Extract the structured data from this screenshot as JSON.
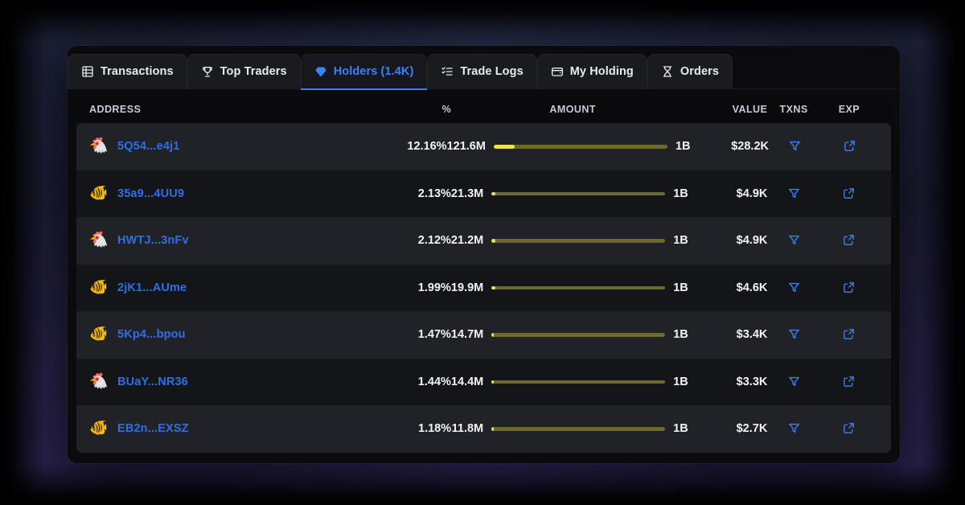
{
  "tabs": [
    {
      "id": "transactions",
      "label": "Transactions",
      "icon": "list-table-icon",
      "active": false
    },
    {
      "id": "top-traders",
      "label": "Top Traders",
      "icon": "trophy-icon",
      "active": false
    },
    {
      "id": "holders",
      "label": "Holders (1.4K)",
      "icon": "gem-icon",
      "active": true
    },
    {
      "id": "trade-logs",
      "label": "Trade Logs",
      "icon": "list-check-icon",
      "active": false
    },
    {
      "id": "my-holding",
      "label": "My Holding",
      "icon": "wallet-icon",
      "active": false
    },
    {
      "id": "orders",
      "label": "Orders",
      "icon": "hourglass-icon",
      "active": false
    }
  ],
  "table": {
    "columns": {
      "address": "ADDRESS",
      "percent": "%",
      "amount": "AMOUNT",
      "value": "VALUE",
      "txns": "TXNS",
      "exp": "EXP"
    },
    "row_icons": {
      "txns": "filter-funnel-icon",
      "exp": "external-link-icon"
    },
    "rows": [
      {
        "avatar": "chicken",
        "avatar_glyph": "🐔",
        "address": "5Q54...e4j1",
        "percent": "12.16%",
        "percent_value": 12.16,
        "amount": "121.6M",
        "total": "1B",
        "value": "$28.2K"
      },
      {
        "avatar": "fish",
        "avatar_glyph": "🐠",
        "address": "35a9...4UU9",
        "percent": "2.13%",
        "percent_value": 2.13,
        "amount": "21.3M",
        "total": "1B",
        "value": "$4.9K"
      },
      {
        "avatar": "chicken",
        "avatar_glyph": "🐔",
        "address": "HWTJ...3nFv",
        "percent": "2.12%",
        "percent_value": 2.12,
        "amount": "21.2M",
        "total": "1B",
        "value": "$4.9K"
      },
      {
        "avatar": "fish",
        "avatar_glyph": "🐠",
        "address": "2jK1...AUme",
        "percent": "1.99%",
        "percent_value": 1.99,
        "amount": "19.9M",
        "total": "1B",
        "value": "$4.6K"
      },
      {
        "avatar": "fish",
        "avatar_glyph": "🐠",
        "address": "5Kp4...bpou",
        "percent": "1.47%",
        "percent_value": 1.47,
        "amount": "14.7M",
        "total": "1B",
        "value": "$3.4K"
      },
      {
        "avatar": "chicken",
        "avatar_glyph": "🐔",
        "address": "BUaY...NR36",
        "percent": "1.44%",
        "percent_value": 1.44,
        "amount": "14.4M",
        "total": "1B",
        "value": "$3.3K"
      },
      {
        "avatar": "fish",
        "avatar_glyph": "🐠",
        "address": "EB2n...EXSZ",
        "percent": "1.18%",
        "percent_value": 1.18,
        "amount": "11.8M",
        "total": "1B",
        "value": "$2.7K"
      }
    ]
  },
  "colors": {
    "accent_blue": "#3b82f6",
    "link_blue": "#2f6fe4",
    "bar_fill": "#f2e14f",
    "bar_track": "#6e6a2c",
    "row_odd": "#212227",
    "row_even": "#141519",
    "panel_bg": "#0b0b0e"
  }
}
